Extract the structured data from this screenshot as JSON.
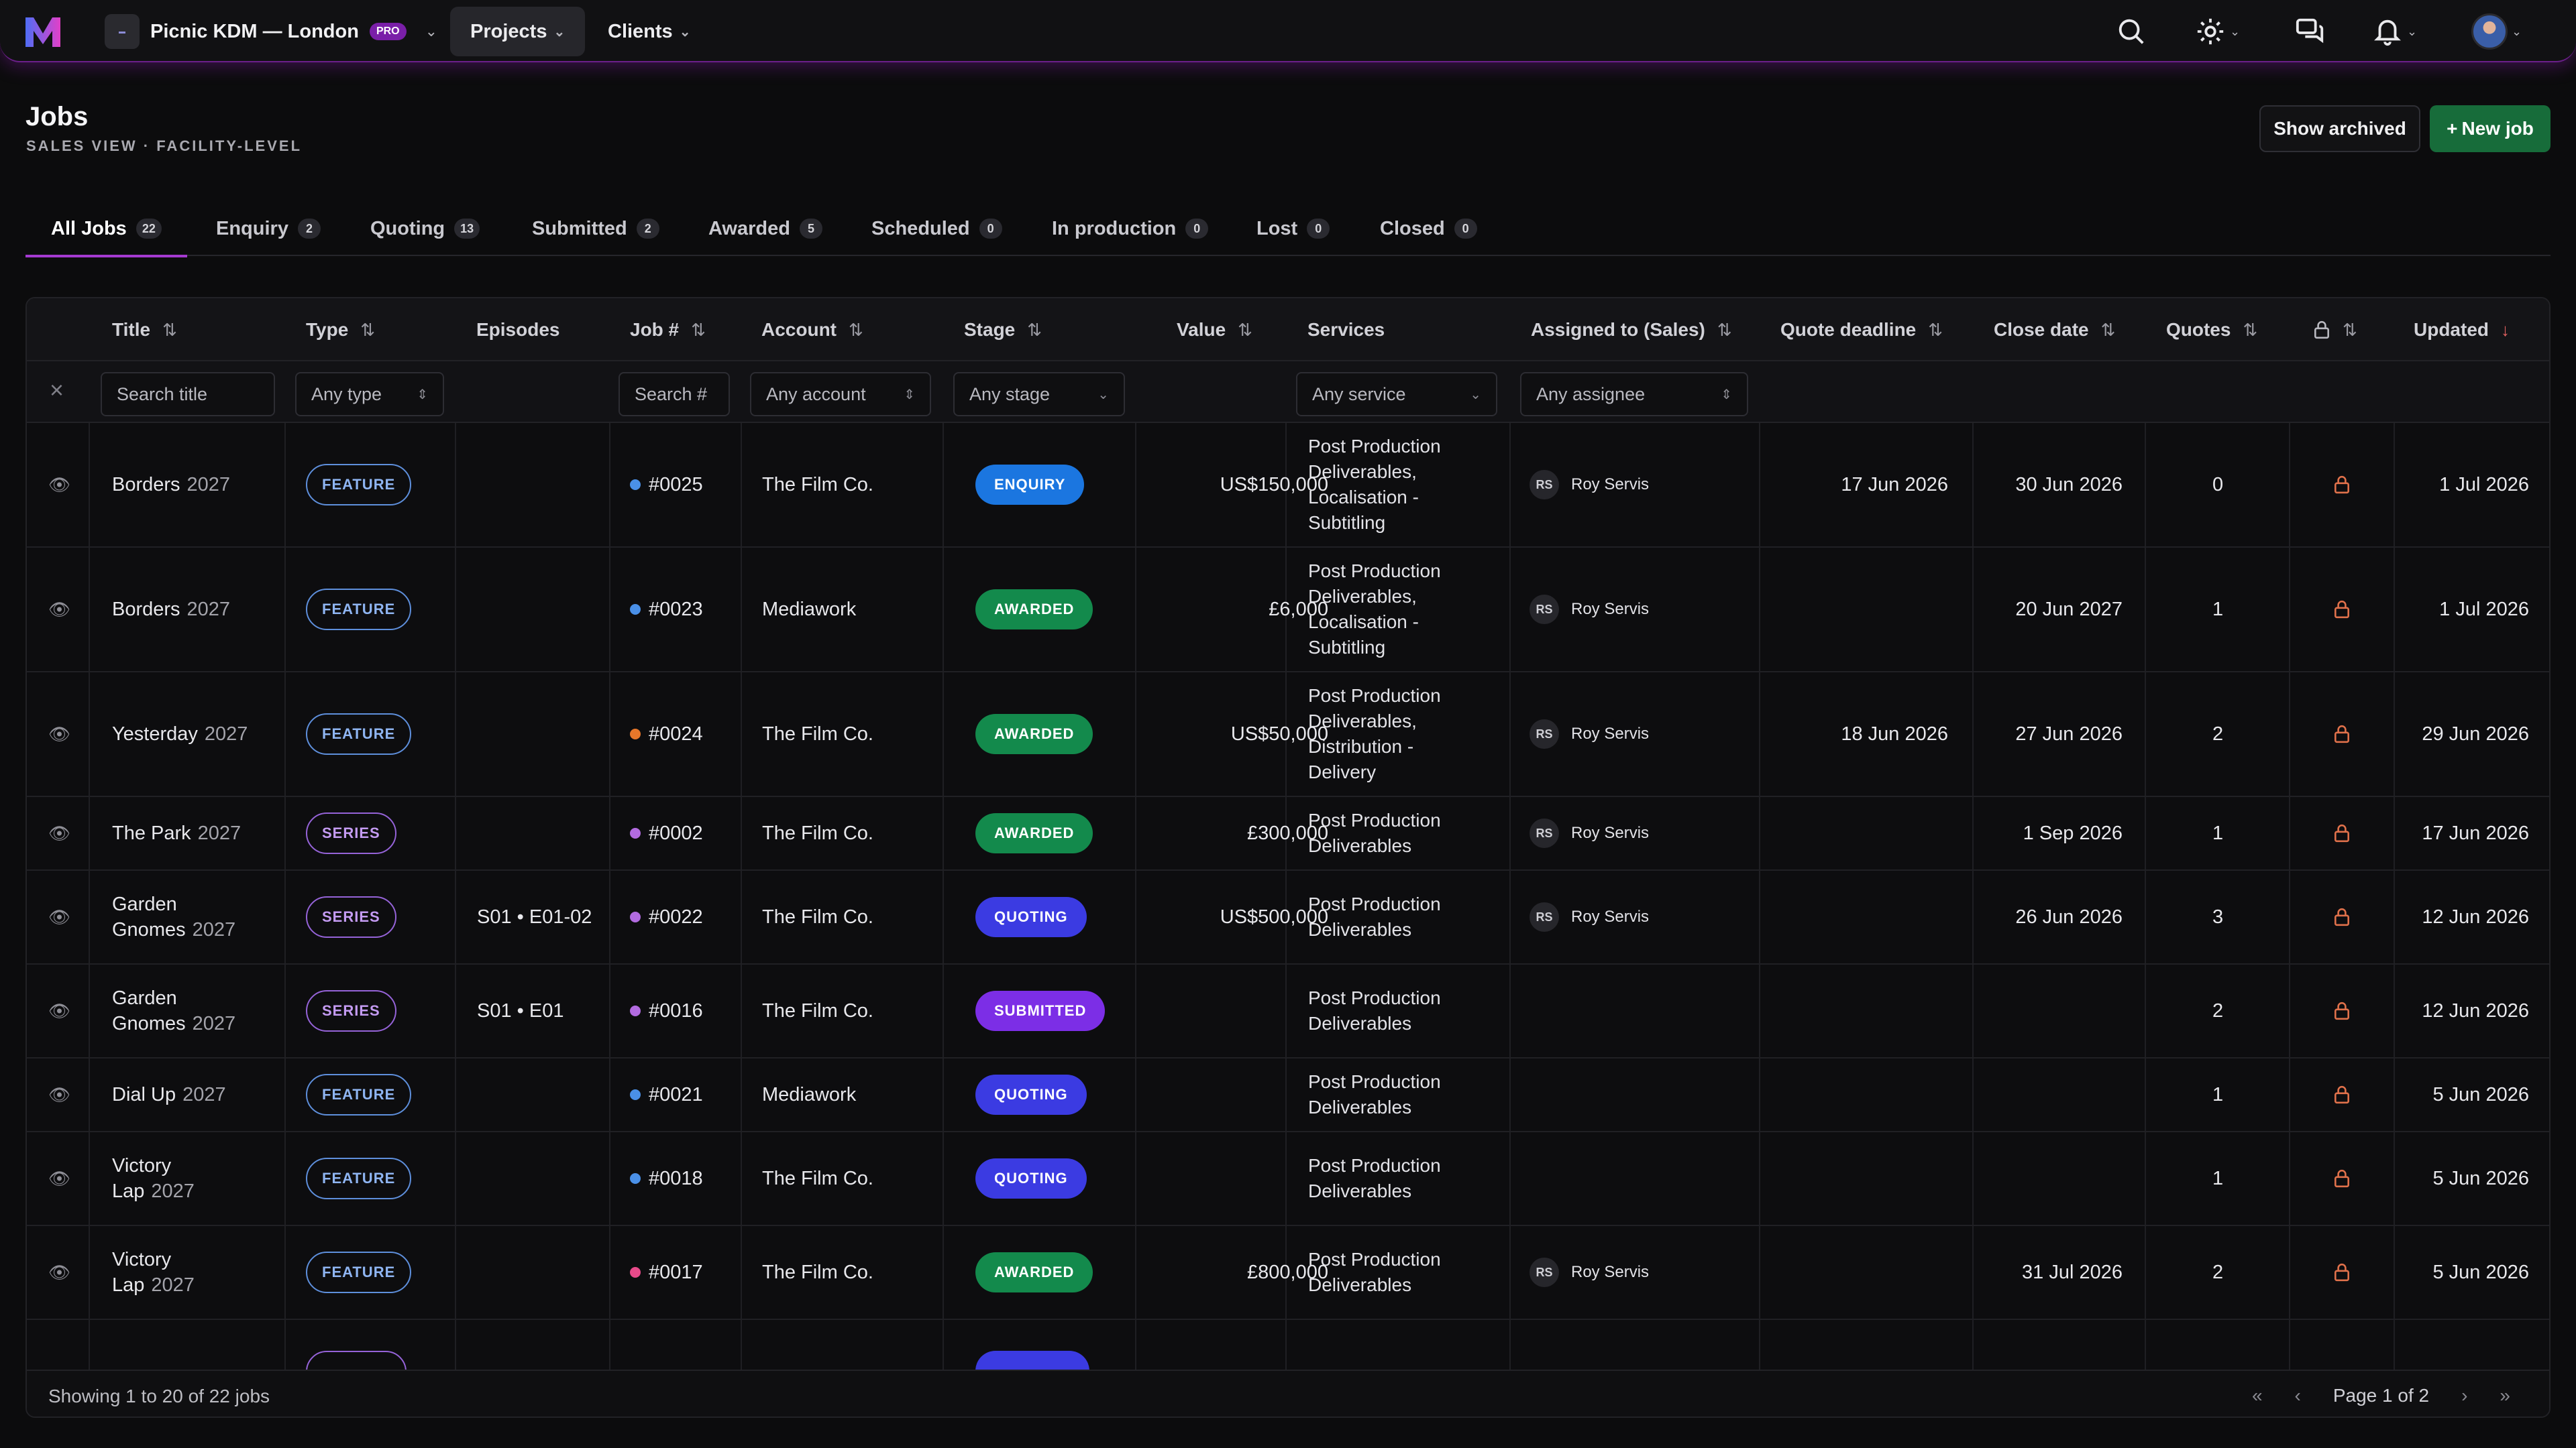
{
  "nav": {
    "org_name": "Picnic KDM — London",
    "org_badge": "PRO",
    "menu": [
      "Projects",
      "Clients"
    ]
  },
  "header": {
    "title": "Jobs",
    "subtitle": "SALES VIEW · FACILITY-LEVEL",
    "show_archived": "Show archived",
    "new_job": "New job"
  },
  "tabs": [
    {
      "label": "All Jobs",
      "count": "22"
    },
    {
      "label": "Enquiry",
      "count": "2"
    },
    {
      "label": "Quoting",
      "count": "13"
    },
    {
      "label": "Submitted",
      "count": "2"
    },
    {
      "label": "Awarded",
      "count": "5"
    },
    {
      "label": "Scheduled",
      "count": "0"
    },
    {
      "label": "In production",
      "count": "0"
    },
    {
      "label": "Lost",
      "count": "0"
    },
    {
      "label": "Closed",
      "count": "0"
    }
  ],
  "columns": {
    "title": "Title",
    "type": "Type",
    "episodes": "Episodes",
    "job": "Job #",
    "account": "Account",
    "stage": "Stage",
    "value": "Value",
    "services": "Services",
    "assigned": "Assigned to (Sales)",
    "quote_deadline": "Quote deadline",
    "close_date": "Close date",
    "quotes": "Quotes",
    "updated": "Updated"
  },
  "filters": {
    "title": "Search title",
    "type": "Any type",
    "job": "Search #",
    "account": "Any account",
    "stage": "Any stage",
    "service": "Any service",
    "assignee": "Any assignee"
  },
  "colors": {
    "feature": "#5e8fdc",
    "series": "#9563d8",
    "enquiry": "#1b76e0",
    "awarded": "#138a4c",
    "quoting": "#3b3be2",
    "submitted": "#7c2ee6"
  },
  "rows": [
    {
      "title": "Borders",
      "year": "2027",
      "type": "FEATURE",
      "episodes": "",
      "job": "#0025",
      "dot": "#4a90e8",
      "account": "The Film Co.",
      "stage": "ENQUIRY",
      "stage_color": "#1b76e0",
      "value": "US$150,000",
      "services": [
        "Post Production",
        "Deliverables,",
        "Localisation -",
        "Subtitling"
      ],
      "initials": "RS",
      "assignee": "Roy Servis",
      "quote_deadline": "17 Jun 2026",
      "close_date": "30 Jun 2026",
      "quotes": "0",
      "updated": "1 Jul 2026"
    },
    {
      "title": "Borders",
      "year": "2027",
      "type": "FEATURE",
      "episodes": "",
      "job": "#0023",
      "dot": "#4a90e8",
      "account": "Mediawork",
      "stage": "AWARDED",
      "stage_color": "#138a4c",
      "value": "£6,000",
      "services": [
        "Post Production",
        "Deliverables,",
        "Localisation -",
        "Subtitling"
      ],
      "initials": "RS",
      "assignee": "Roy Servis",
      "quote_deadline": "",
      "close_date": "20 Jun 2027",
      "quotes": "1",
      "updated": "1 Jul 2026"
    },
    {
      "title": "Yesterday",
      "year": "2027",
      "type": "FEATURE",
      "episodes": "",
      "job": "#0024",
      "dot": "#e8772a",
      "account": "The Film Co.",
      "stage": "AWARDED",
      "stage_color": "#138a4c",
      "value": "US$50,000",
      "services": [
        "Post Production",
        "Deliverables,",
        "Distribution -",
        "Delivery"
      ],
      "initials": "RS",
      "assignee": "Roy Servis",
      "quote_deadline": "18 Jun 2026",
      "close_date": "27 Jun 2026",
      "quotes": "2",
      "updated": "29 Jun 2026"
    },
    {
      "title": "The Park",
      "year": "2027",
      "type": "SERIES",
      "episodes": "",
      "job": "#0002",
      "dot": "#b26be0",
      "account": "The Film Co.",
      "stage": "AWARDED",
      "stage_color": "#138a4c",
      "value": "£300,000",
      "services": [
        "Post Production",
        "Deliverables"
      ],
      "initials": "RS",
      "assignee": "Roy Servis",
      "quote_deadline": "",
      "close_date": "1 Sep 2026",
      "quotes": "1",
      "updated": "17 Jun 2026"
    },
    {
      "title": "Garden",
      "title2": "Gnomes",
      "year": "2027",
      "type": "SERIES",
      "episodes": "S01 • E01-02",
      "job": "#0022",
      "dot": "#b26be0",
      "account": "The Film Co.",
      "stage": "QUOTING",
      "stage_color": "#3b3be2",
      "value": "US$500,000",
      "services": [
        "Post Production",
        "Deliverables"
      ],
      "initials": "RS",
      "assignee": "Roy Servis",
      "quote_deadline": "",
      "close_date": "26 Jun 2026",
      "quotes": "3",
      "updated": "12 Jun 2026"
    },
    {
      "title": "Garden",
      "title2": "Gnomes",
      "year": "2027",
      "type": "SERIES",
      "episodes": "S01 • E01",
      "job": "#0016",
      "dot": "#b26be0",
      "account": "The Film Co.",
      "stage": "SUBMITTED",
      "stage_color": "#7c2ee6",
      "value": "",
      "services": [
        "Post Production",
        "Deliverables"
      ],
      "initials": "",
      "assignee": "",
      "quote_deadline": "",
      "close_date": "",
      "quotes": "2",
      "updated": "12 Jun 2026"
    },
    {
      "title": "Dial Up",
      "year": "2027",
      "type": "FEATURE",
      "episodes": "",
      "job": "#0021",
      "dot": "#4a90e8",
      "account": "Mediawork",
      "stage": "QUOTING",
      "stage_color": "#3b3be2",
      "value": "",
      "services": [
        "Post Production",
        "Deliverables"
      ],
      "initials": "",
      "assignee": "",
      "quote_deadline": "",
      "close_date": "",
      "quotes": "1",
      "updated": "5 Jun 2026"
    },
    {
      "title": "Victory",
      "title2": "Lap",
      "year": "2027",
      "type": "FEATURE",
      "episodes": "",
      "job": "#0018",
      "dot": "#4a90e8",
      "account": "The Film Co.",
      "stage": "QUOTING",
      "stage_color": "#3b3be2",
      "value": "",
      "services": [
        "Post Production",
        "Deliverables"
      ],
      "initials": "",
      "assignee": "",
      "quote_deadline": "",
      "close_date": "",
      "quotes": "1",
      "updated": "5 Jun 2026"
    },
    {
      "title": "Victory",
      "title2": "Lap",
      "year": "2027",
      "type": "FEATURE",
      "episodes": "",
      "job": "#0017",
      "dot": "#e84a8a",
      "account": "The Film Co.",
      "stage": "AWARDED",
      "stage_color": "#138a4c",
      "value": "£800,000",
      "services": [
        "Post Production",
        "Deliverables"
      ],
      "initials": "RS",
      "assignee": "Roy Servis",
      "quote_deadline": "",
      "close_date": "31 Jul 2026",
      "quotes": "2",
      "updated": "5 Jun 2026"
    }
  ],
  "footer": {
    "summary": "Showing 1 to 20 of 22 jobs",
    "page": "Page 1 of 2"
  }
}
